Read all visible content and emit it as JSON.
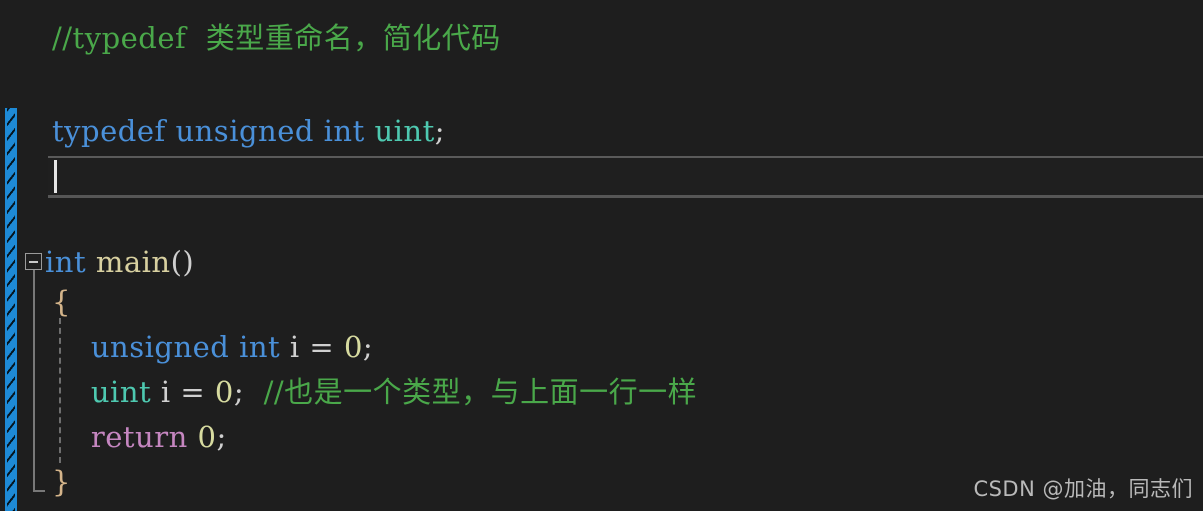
{
  "editor": {
    "background_color": "#1e1e1e",
    "gutter": {
      "change_marker_color": "#1e8ad6",
      "change_marker_name": "unsaved-change-bar",
      "collapse_toggle_state": "expanded",
      "collapse_toggle_glyph": "minus"
    },
    "cursor": {
      "line_index": 3,
      "column": 1
    }
  },
  "code": {
    "lines": [
      {
        "id": "line-comment-typedef",
        "indent": 0,
        "tokens": [
          {
            "text": "//typedef  类型重命名，简化代码",
            "type": "comment"
          }
        ]
      },
      {
        "id": "line-blank-1",
        "indent": 0,
        "tokens": []
      },
      {
        "id": "line-typedef-decl",
        "indent": 0,
        "tokens": [
          {
            "text": "typedef",
            "type": "keyword"
          },
          {
            "text": " ",
            "type": "plain"
          },
          {
            "text": "unsigned",
            "type": "keyword"
          },
          {
            "text": " ",
            "type": "plain"
          },
          {
            "text": "int",
            "type": "keyword"
          },
          {
            "text": " ",
            "type": "plain"
          },
          {
            "text": "uint",
            "type": "type"
          },
          {
            "text": ";",
            "type": "punct"
          }
        ]
      },
      {
        "id": "line-current-empty",
        "indent": 0,
        "tokens": []
      },
      {
        "id": "line-blank-2",
        "indent": 0,
        "tokens": []
      },
      {
        "id": "line-main-signature",
        "indent": 0,
        "tokens": [
          {
            "text": "int",
            "type": "keyword"
          },
          {
            "text": " ",
            "type": "plain"
          },
          {
            "text": "main",
            "type": "func"
          },
          {
            "text": "()",
            "type": "punct"
          }
        ]
      },
      {
        "id": "line-open-brace",
        "indent": 0,
        "tokens": [
          {
            "text": "{",
            "type": "brace"
          }
        ]
      },
      {
        "id": "line-unsigned-i",
        "indent": 1,
        "tokens": [
          {
            "text": "unsigned",
            "type": "keyword"
          },
          {
            "text": " ",
            "type": "plain"
          },
          {
            "text": "int",
            "type": "keyword"
          },
          {
            "text": " ",
            "type": "plain"
          },
          {
            "text": "i",
            "type": "plain"
          },
          {
            "text": " ",
            "type": "plain"
          },
          {
            "text": "=",
            "type": "punct"
          },
          {
            "text": " ",
            "type": "plain"
          },
          {
            "text": "0",
            "type": "num"
          },
          {
            "text": ";",
            "type": "punct"
          }
        ]
      },
      {
        "id": "line-uint-i",
        "indent": 1,
        "tokens": [
          {
            "text": "uint",
            "type": "type"
          },
          {
            "text": " ",
            "type": "plain"
          },
          {
            "text": "i",
            "type": "plain"
          },
          {
            "text": " ",
            "type": "plain"
          },
          {
            "text": "=",
            "type": "punct"
          },
          {
            "text": " ",
            "type": "plain"
          },
          {
            "text": "0",
            "type": "num"
          },
          {
            "text": ";",
            "type": "punct"
          },
          {
            "text": "  ",
            "type": "plain"
          },
          {
            "text": "//也是一个类型，与上面一行一样",
            "type": "comment"
          }
        ]
      },
      {
        "id": "line-return",
        "indent": 1,
        "tokens": [
          {
            "text": "return",
            "type": "ctrl"
          },
          {
            "text": " ",
            "type": "plain"
          },
          {
            "text": "0",
            "type": "num"
          },
          {
            "text": ";",
            "type": "punct"
          }
        ]
      },
      {
        "id": "line-close-brace",
        "indent": 0,
        "tokens": [
          {
            "text": "}",
            "type": "brace"
          }
        ]
      }
    ]
  },
  "watermark": {
    "text": "CSDN @加油，同志们"
  },
  "colors": {
    "comment": "#4aa84a",
    "keyword": "#4a90d9",
    "type": "#4ec9b0",
    "function": "#d8d0a0",
    "control": "#c586c0",
    "number": "#d7dba0",
    "brace": "#d4b48a",
    "background": "#1e1e1e",
    "change_bar": "#1e8ad6"
  }
}
